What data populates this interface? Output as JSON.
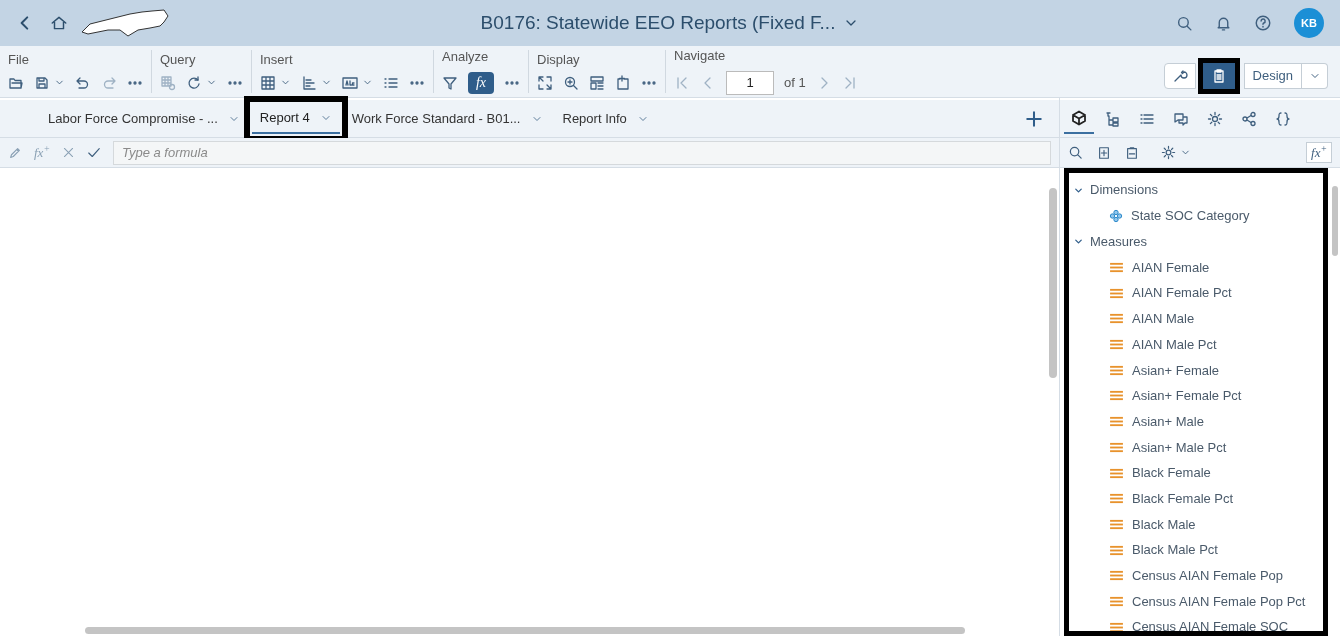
{
  "header": {
    "title": "B0176: Statewide EEO Reports (Fixed F...",
    "avatar": "KB"
  },
  "toolbar": {
    "groups": [
      {
        "label": "File"
      },
      {
        "label": "Query"
      },
      {
        "label": "Insert"
      },
      {
        "label": "Analyze",
        "formula_label": "fx",
        "formula_on": true
      },
      {
        "label": "Display"
      },
      {
        "label": "Navigate",
        "page": "1",
        "page_count": "of 1"
      }
    ],
    "view_buttons": [
      {
        "kind": "wrench",
        "selected": false,
        "highlighted": false
      },
      {
        "kind": "clipboard",
        "selected": true,
        "highlighted": true
      }
    ],
    "mode": "Design"
  },
  "tabs": [
    {
      "label": "Labor Force Compromise - ...",
      "selected": false,
      "highlighted": false
    },
    {
      "label": "Report 4",
      "selected": true,
      "highlighted": true
    },
    {
      "label": "Work Force Standard - B01...",
      "selected": false,
      "highlighted": false
    },
    {
      "label": "Report Info",
      "selected": false,
      "highlighted": false
    }
  ],
  "formula_bar": {
    "fx_label": "fx$^{+}$",
    "placeholder": "Type a formula"
  },
  "side_panel": {
    "tabs": [
      {
        "selected": true
      },
      {
        "selected": false
      },
      {
        "selected": false
      },
      {
        "selected": false
      },
      {
        "selected": false
      },
      {
        "selected": false
      },
      {
        "selected": false
      }
    ],
    "fx_label": "fx$^{+}$",
    "highlighted": true,
    "tree": [
      {
        "label": "Dimensions",
        "expanded": true,
        "children": [
          {
            "label": "State SOC Category",
            "kind": "dimension"
          }
        ]
      },
      {
        "label": "Measures",
        "expanded": true,
        "children": [
          {
            "label": "AIAN Female",
            "kind": "measure"
          },
          {
            "label": "AIAN Female Pct",
            "kind": "measure"
          },
          {
            "label": "AIAN Male",
            "kind": "measure"
          },
          {
            "label": "AIAN Male Pct",
            "kind": "measure"
          },
          {
            "label": "Asian+ Female",
            "kind": "measure"
          },
          {
            "label": "Asian+ Female Pct",
            "kind": "measure"
          },
          {
            "label": "Asian+ Male",
            "kind": "measure"
          },
          {
            "label": "Asian+ Male Pct",
            "kind": "measure"
          },
          {
            "label": "Black Female",
            "kind": "measure"
          },
          {
            "label": "Black Female Pct",
            "kind": "measure"
          },
          {
            "label": "Black Male",
            "kind": "measure"
          },
          {
            "label": "Black Male Pct",
            "kind": "measure"
          },
          {
            "label": "Census AIAN Female Pop",
            "kind": "measure"
          },
          {
            "label": "Census AIAN Female Pop Pct",
            "kind": "measure"
          },
          {
            "label": "Census AIAN Female SOC",
            "kind": "measure"
          }
        ]
      }
    ]
  }
}
